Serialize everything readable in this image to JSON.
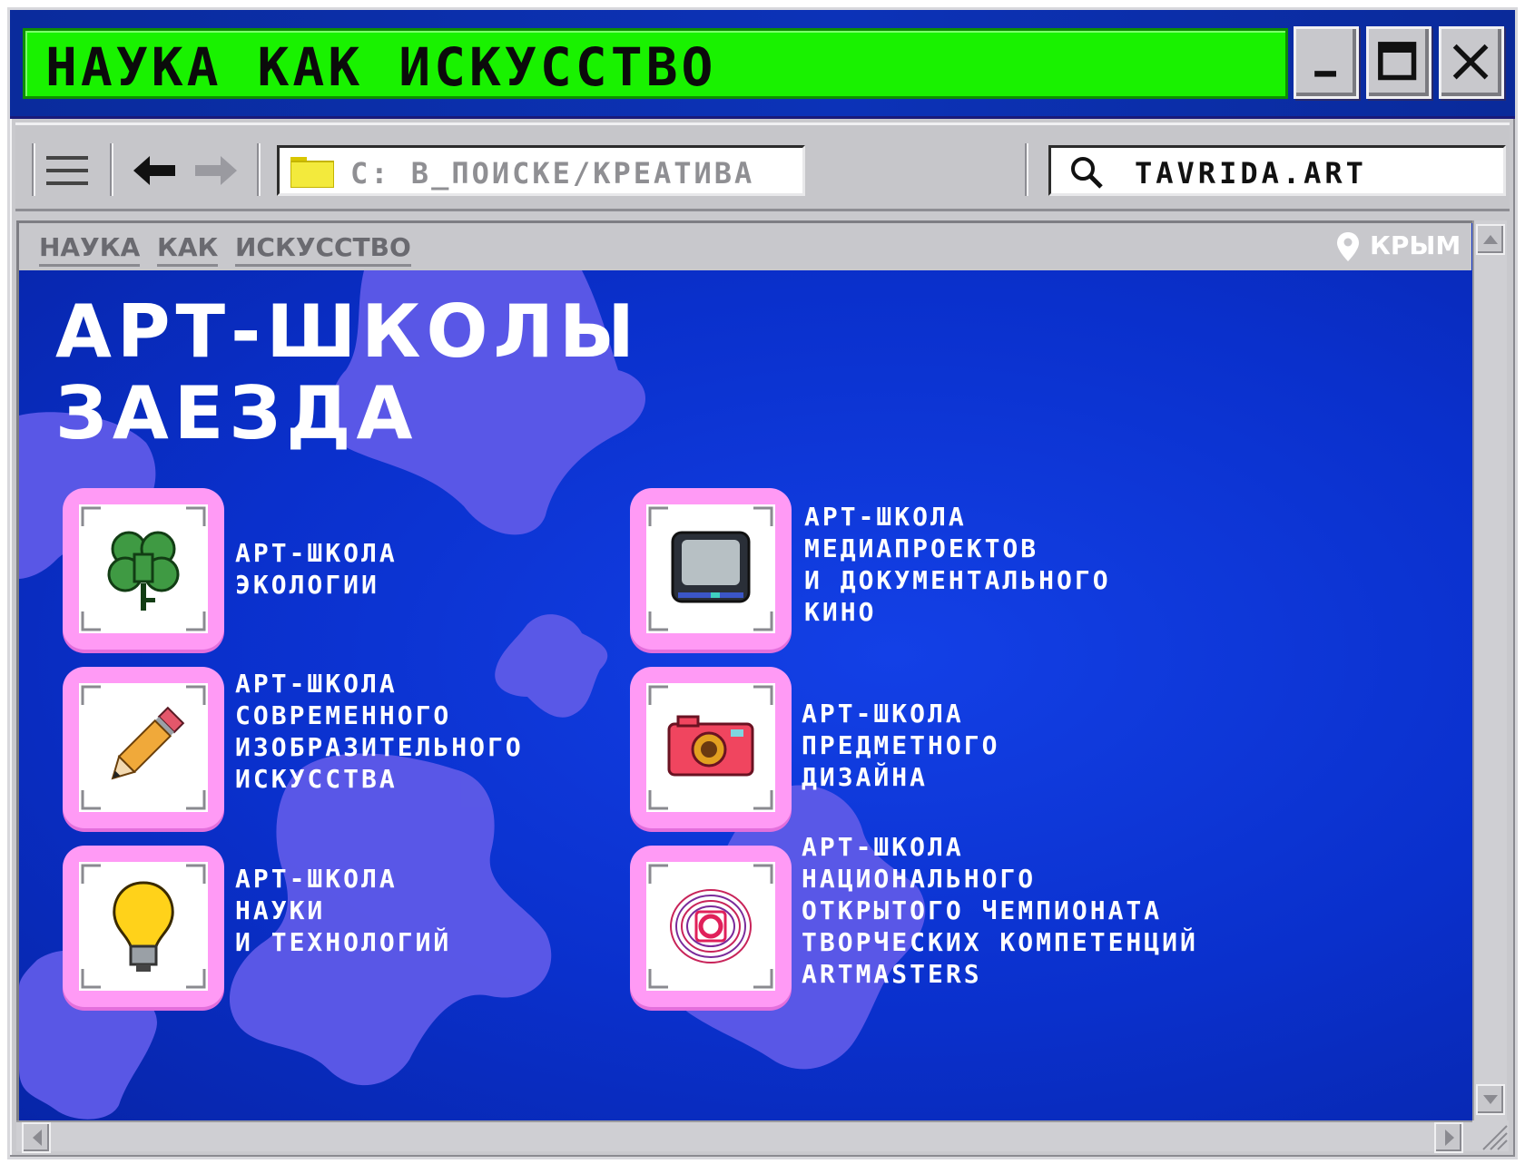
{
  "window": {
    "title": "НАУКА КАК ИСКУССТВО",
    "controls": {
      "minimize": "minimize-icon",
      "maximize": "maximize-icon",
      "close": "close-icon"
    },
    "colors": {
      "titlebar": "#0a2b9c",
      "title_field": "#19f200",
      "content_bg": "#0b2fc4",
      "icon_tile": "#ff9af5",
      "blobs": "#5e5ae8"
    }
  },
  "toolbar": {
    "menu_icon": "hamburger-menu-icon",
    "back_icon": "arrow-left-icon",
    "forward_icon": "arrow-right-icon",
    "path_icon": "folder-icon",
    "path": "С: В_ПОИСКЕ/КРЕАТИВА",
    "search_icon": "search-icon",
    "search_value": "TAVRIDA.ART"
  },
  "nav": {
    "links": [
      "НАУКА",
      "КАК",
      "ИСКУССТВО"
    ],
    "location_icon": "map-pin-icon",
    "location": "КРЫМ"
  },
  "main": {
    "heading_line1": "АРТ-ШКОЛЫ",
    "heading_line2": "ЗАЕЗДА",
    "schools": [
      {
        "icon": "clover-icon",
        "lines": [
          "АРТ-ШКОЛА",
          "ЭКОЛОГИИ"
        ]
      },
      {
        "icon": "tv-icon",
        "lines": [
          "АРТ-ШКОЛА",
          "МЕДИАПРОЕКТОВ",
          "И ДОКУМЕНТАЛЬНОГО",
          "КИНО"
        ]
      },
      {
        "icon": "pencil-icon",
        "lines": [
          "АРТ-ШКОЛА",
          "СОВРЕМЕННОГО",
          "ИЗОБРАЗИТЕЛЬНОГО",
          "ИСКУССТВА"
        ]
      },
      {
        "icon": "camera-icon",
        "lines": [
          "АРТ-ШКОЛА",
          "ПРЕДМЕТНОГО",
          "ДИЗАЙНА"
        ]
      },
      {
        "icon": "lightbulb-icon",
        "lines": [
          "АРТ-ШКОЛА",
          "НАУКИ",
          "И ТЕХНОЛОГИЙ"
        ]
      },
      {
        "icon": "artmasters-logo-icon",
        "lines": [
          "АРТ-ШКОЛА",
          "НАЦИОНАЛЬНОГО",
          "ОТКРЫТОГО ЧЕМПИОНАТА",
          "ТВОРЧЕСКИХ КОМПЕТЕНЦИЙ",
          "ARTMASTERS"
        ]
      }
    ]
  }
}
